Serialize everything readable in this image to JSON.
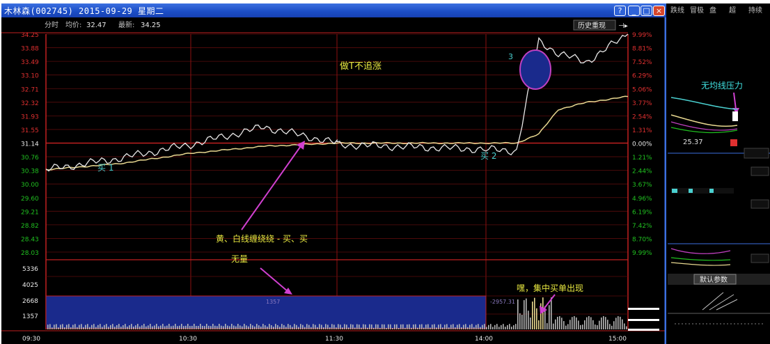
{
  "window": {
    "title": "木林森(002745)  2015-09-29  星期二",
    "buttons": {
      "help": "?",
      "minimize": "_",
      "maximize": "□",
      "close": "×"
    }
  },
  "chart_header": {
    "mode_label": "分时",
    "avg_label": "均价:",
    "avg_value": "32.47",
    "latest_label": "最新:",
    "latest_value": "34.25",
    "history_button": "历史重现",
    "collapse_glyph": "⊣▸"
  },
  "toolbar_right": [
    "跌线",
    "冒极",
    "盘",
    "超",
    "持续"
  ],
  "right_panel": {
    "annotation": "无均线压力",
    "price_label": "25.37",
    "default_params": "默认参数"
  },
  "annotations": {
    "center_title": "做T不追涨",
    "circle_num": "3",
    "buy1": "买 1",
    "buy2": "买 2",
    "swing_note": "黄、白线缠绕绕 - 买、买",
    "no_volume": "无量",
    "volume_note": "嘿，集中买单出现",
    "vol_box_label": "1357",
    "vol_box_label2": "-2957.31"
  },
  "axes": {
    "left_prices": [
      "34.25",
      "33.88",
      "33.49",
      "33.10",
      "32.71",
      "32.32",
      "31.93",
      "31.55",
      "31.14",
      "30.76",
      "30.38",
      "30.00",
      "29.60",
      "29.21",
      "28.82",
      "28.43",
      "28.03"
    ],
    "right_pcts": [
      "9.99%",
      "8.81%",
      "7.52%",
      "6.29%",
      "5.06%",
      "3.77%",
      "2.54%",
      "1.31%",
      "0.00%",
      "1.21%",
      "2.44%",
      "3.67%",
      "4.96%",
      "6.19%",
      "7.42%",
      "8.70%",
      "9.99%"
    ],
    "volume_ticks": [
      "5336",
      "4025",
      "2668",
      "1357"
    ],
    "times": [
      "09:30",
      "10:30",
      "11:30",
      "14:00",
      "15:00"
    ]
  },
  "chart_data": {
    "type": "line",
    "x": [
      "09:30",
      "10:00",
      "10:30",
      "11:00",
      "11:30",
      "13:30",
      "14:00",
      "14:10",
      "14:13",
      "14:20",
      "14:30",
      "15:00"
    ],
    "series": [
      {
        "values": [
          30.38,
          30.7,
          31.1,
          31.6,
          31.14,
          31.1,
          30.96,
          30.92,
          34.05,
          33.7,
          33.45,
          34.25
        ]
      },
      {
        "values": [
          30.38,
          30.55,
          30.85,
          31.05,
          31.14,
          31.14,
          31.14,
          31.14,
          31.4,
          32.1,
          32.3,
          32.47
        ]
      }
    ],
    "ylim": [
      28.03,
      34.25
    ],
    "prev_close": 31.14,
    "colors": {
      "price_line": "#e8e8e8",
      "avg_line": "#e8d890",
      "grid": "#8b1010",
      "up": "#e03030",
      "down": "#20c020",
      "volume": "#b8b8b8",
      "volume_box": "#1a2a8c"
    }
  }
}
